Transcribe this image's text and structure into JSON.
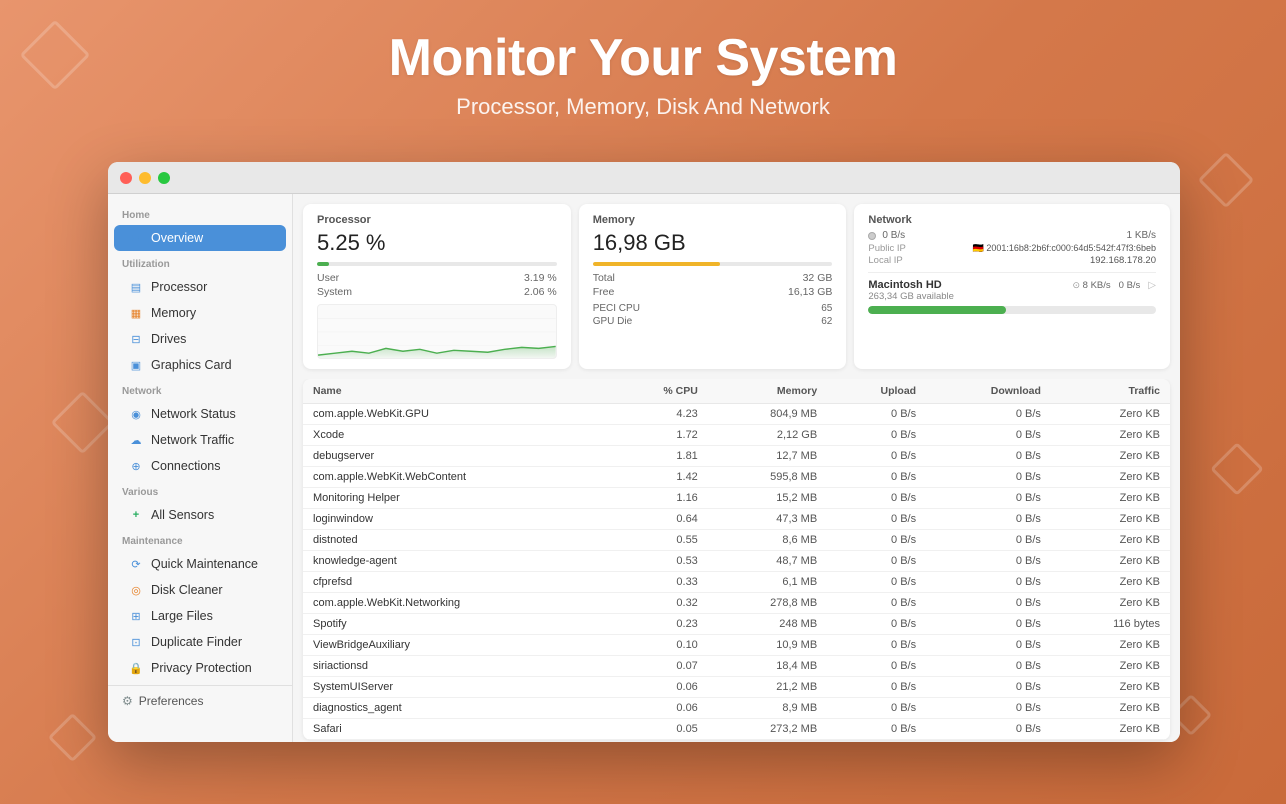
{
  "header": {
    "title": "Monitor Your System",
    "subtitle": "Processor, Memory, Disk And Network"
  },
  "sidebar": {
    "home_label": "Home",
    "overview_label": "Overview",
    "utilization_label": "Utilization",
    "items_utilization": [
      {
        "id": "processor",
        "label": "Processor",
        "icon": "▤"
      },
      {
        "id": "memory",
        "label": "Memory",
        "icon": "▦"
      },
      {
        "id": "drives",
        "label": "Drives",
        "icon": "⊟"
      },
      {
        "id": "graphics",
        "label": "Graphics Card",
        "icon": "▣"
      }
    ],
    "network_label": "Network",
    "items_network": [
      {
        "id": "network-status",
        "label": "Network Status",
        "icon": "◉"
      },
      {
        "id": "network-traffic",
        "label": "Network Traffic",
        "icon": "☁"
      },
      {
        "id": "connections",
        "label": "Connections",
        "icon": "⊕"
      }
    ],
    "various_label": "Various",
    "items_various": [
      {
        "id": "all-sensors",
        "label": "All Sensors",
        "icon": "+"
      }
    ],
    "maintenance_label": "Maintenance",
    "items_maintenance": [
      {
        "id": "quick-maintenance",
        "label": "Quick Maintenance",
        "icon": "⟳"
      },
      {
        "id": "disk-cleaner",
        "label": "Disk Cleaner",
        "icon": "◎"
      },
      {
        "id": "large-files",
        "label": "Large Files",
        "icon": "⊞"
      },
      {
        "id": "duplicate-finder",
        "label": "Duplicate Finder",
        "icon": "⊡"
      },
      {
        "id": "privacy-protection",
        "label": "Privacy Protection",
        "icon": "🔒"
      }
    ],
    "preferences_label": "Preferences"
  },
  "processor_panel": {
    "title": "Processor",
    "value": "5.25 %",
    "user_label": "User",
    "user_value": "3.19 %",
    "system_label": "System",
    "system_value": "2.06 %",
    "fill_percent": 5
  },
  "memory_panel": {
    "title": "Memory",
    "value": "16,98 GB",
    "total_label": "Total",
    "total_value": "32 GB",
    "free_label": "Free",
    "free_value": "16,13 GB",
    "fill_percent": 53,
    "peci_label": "PECI CPU",
    "peci_value": "65",
    "gpu_die_label": "GPU Die",
    "gpu_die_value": "62"
  },
  "network_panel": {
    "title": "Network",
    "download_speed": "0 B/s",
    "upload_speed": "1 KB/s",
    "public_ip_label": "Public IP",
    "public_ip_value": "🇩🇪 2001:16b8:2b6f:c000:64d5:542f:47f3:6beb",
    "local_ip_label": "Local IP",
    "local_ip_value": "192.168.178.20",
    "disk_title": "Macintosh HD",
    "disk_available": "263,34 GB available",
    "disk_read_speed": "8 KB/s",
    "disk_write_speed": "0 B/s",
    "disk_fill_percent": 48
  },
  "process_table": {
    "columns": [
      "Name",
      "% CPU",
      "Memory",
      "Upload",
      "Download",
      "Traffic"
    ],
    "rows": [
      {
        "name": "com.apple.WebKit.GPU",
        "cpu": "4.23",
        "memory": "804,9 MB",
        "upload": "0 B/s",
        "download": "0 B/s",
        "traffic": "Zero KB"
      },
      {
        "name": "Xcode",
        "cpu": "1.72",
        "memory": "2,12 GB",
        "upload": "0 B/s",
        "download": "0 B/s",
        "traffic": "Zero KB"
      },
      {
        "name": "debugserver",
        "cpu": "1.81",
        "memory": "12,7 MB",
        "upload": "0 B/s",
        "download": "0 B/s",
        "traffic": "Zero KB"
      },
      {
        "name": "com.apple.WebKit.WebContent",
        "cpu": "1.42",
        "memory": "595,8 MB",
        "upload": "0 B/s",
        "download": "0 B/s",
        "traffic": "Zero KB"
      },
      {
        "name": "Monitoring Helper",
        "cpu": "1.16",
        "memory": "15,2 MB",
        "upload": "0 B/s",
        "download": "0 B/s",
        "traffic": "Zero KB"
      },
      {
        "name": "loginwindow",
        "cpu": "0.64",
        "memory": "47,3 MB",
        "upload": "0 B/s",
        "download": "0 B/s",
        "traffic": "Zero KB"
      },
      {
        "name": "distnoted",
        "cpu": "0.55",
        "memory": "8,6 MB",
        "upload": "0 B/s",
        "download": "0 B/s",
        "traffic": "Zero KB"
      },
      {
        "name": "knowledge-agent",
        "cpu": "0.53",
        "memory": "48,7 MB",
        "upload": "0 B/s",
        "download": "0 B/s",
        "traffic": "Zero KB"
      },
      {
        "name": "cfprefsd",
        "cpu": "0.33",
        "memory": "6,1 MB",
        "upload": "0 B/s",
        "download": "0 B/s",
        "traffic": "Zero KB"
      },
      {
        "name": "com.apple.WebKit.Networking",
        "cpu": "0.32",
        "memory": "278,8 MB",
        "upload": "0 B/s",
        "download": "0 B/s",
        "traffic": "Zero KB"
      },
      {
        "name": "Spotify",
        "cpu": "0.23",
        "memory": "248 MB",
        "upload": "0 B/s",
        "download": "0 B/s",
        "traffic": "116 bytes"
      },
      {
        "name": "ViewBridgeAuxiliary",
        "cpu": "0.10",
        "memory": "10,9 MB",
        "upload": "0 B/s",
        "download": "0 B/s",
        "traffic": "Zero KB"
      },
      {
        "name": "siriactionsd",
        "cpu": "0.07",
        "memory": "18,4 MB",
        "upload": "0 B/s",
        "download": "0 B/s",
        "traffic": "Zero KB"
      },
      {
        "name": "SystemUIServer",
        "cpu": "0.06",
        "memory": "21,2 MB",
        "upload": "0 B/s",
        "download": "0 B/s",
        "traffic": "Zero KB"
      },
      {
        "name": "diagnostics_agent",
        "cpu": "0.06",
        "memory": "8,9 MB",
        "upload": "0 B/s",
        "download": "0 B/s",
        "traffic": "Zero KB"
      },
      {
        "name": "Safari",
        "cpu": "0.05",
        "memory": "273,2 MB",
        "upload": "0 B/s",
        "download": "0 B/s",
        "traffic": "Zero KB"
      }
    ]
  }
}
